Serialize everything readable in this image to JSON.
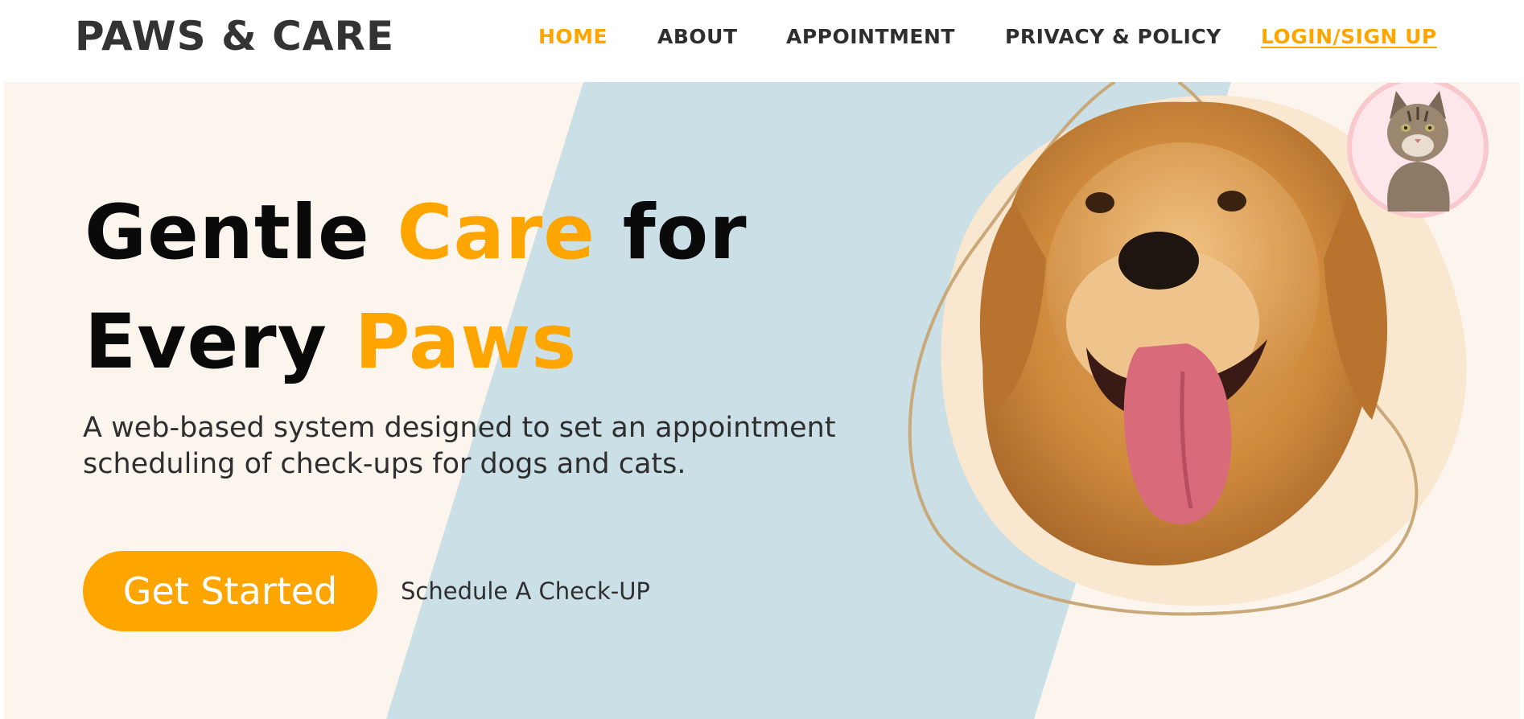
{
  "brand": {
    "name": "PAWS & CARE"
  },
  "nav": {
    "items": [
      {
        "label": "HOME",
        "active": true
      },
      {
        "label": "ABOUT",
        "active": false
      },
      {
        "label": "APPOINTMENT",
        "active": false
      },
      {
        "label": "PRIVACY & POLICY",
        "active": false
      }
    ],
    "login_label": "LOGIN/SIGN UP"
  },
  "hero": {
    "headline_line1_a": "Gentle ",
    "headline_line1_accent": "Care",
    "headline_line1_b": " for",
    "headline_line2_a": "Every ",
    "headline_line2_accent": "Paws",
    "subtitle": "A web-based system designed to set an appointment scheduling of check-ups for dogs and cats.",
    "cta_label": "Get Started",
    "secondary_label": "Schedule A Check-UP"
  },
  "images": {
    "dog_icon": "golden-retriever-photo",
    "cat_icon": "tabby-cat-photo"
  },
  "colors": {
    "accent": "#ffa500",
    "hero_bg": "#fbf5ee",
    "stripe": "#cadfe6",
    "blob": "#fae7d0",
    "cat_circle": "#f8c8cd"
  }
}
